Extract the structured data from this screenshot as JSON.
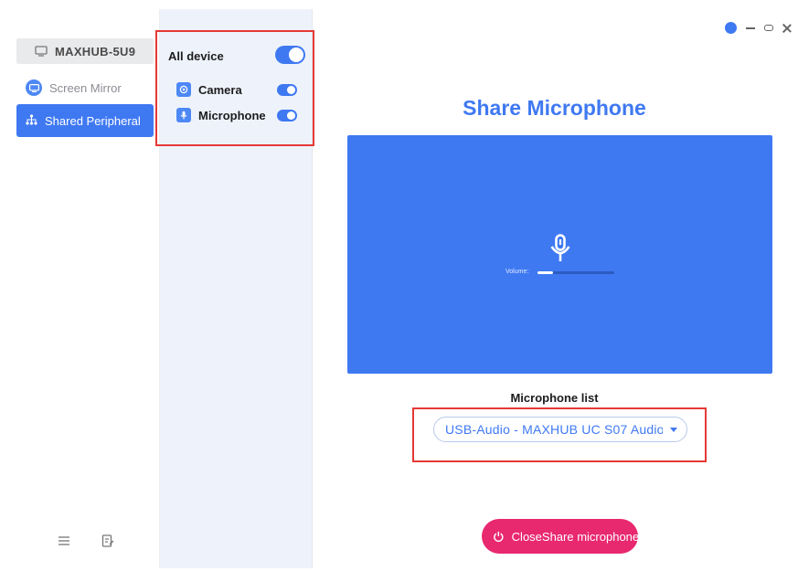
{
  "sidebar": {
    "device_name": "MAXHUB-5U9",
    "items": [
      {
        "label": "Screen Mirror",
        "icon": "screen-mirror-icon",
        "active": false
      },
      {
        "label": "Shared Peripheral",
        "icon": "shared-peripheral-icon",
        "active": true
      }
    ],
    "bottom_icons": [
      "menu-icon",
      "notes-icon"
    ]
  },
  "devices": {
    "all_label": "All device",
    "all_enabled": true,
    "list": [
      {
        "label": "Camera",
        "icon": "camera-icon",
        "enabled": true
      },
      {
        "label": "Microphone",
        "icon": "microphone-icon",
        "enabled": true
      }
    ]
  },
  "main": {
    "title": "Share Microphone",
    "volume_label": "Volume:",
    "volume_level": 0.2,
    "mic_list_label": "Microphone list",
    "selected_microphone": "USB-Audio - MAXHUB UC S07 Audio",
    "close_button_label": "CloseShare microphone"
  },
  "window_controls": [
    "status-icon",
    "minimize-icon",
    "maximize-icon",
    "close-icon"
  ],
  "colors": {
    "accent": "#3f79f2",
    "danger": "#e8286f",
    "highlight": "#e53935"
  }
}
